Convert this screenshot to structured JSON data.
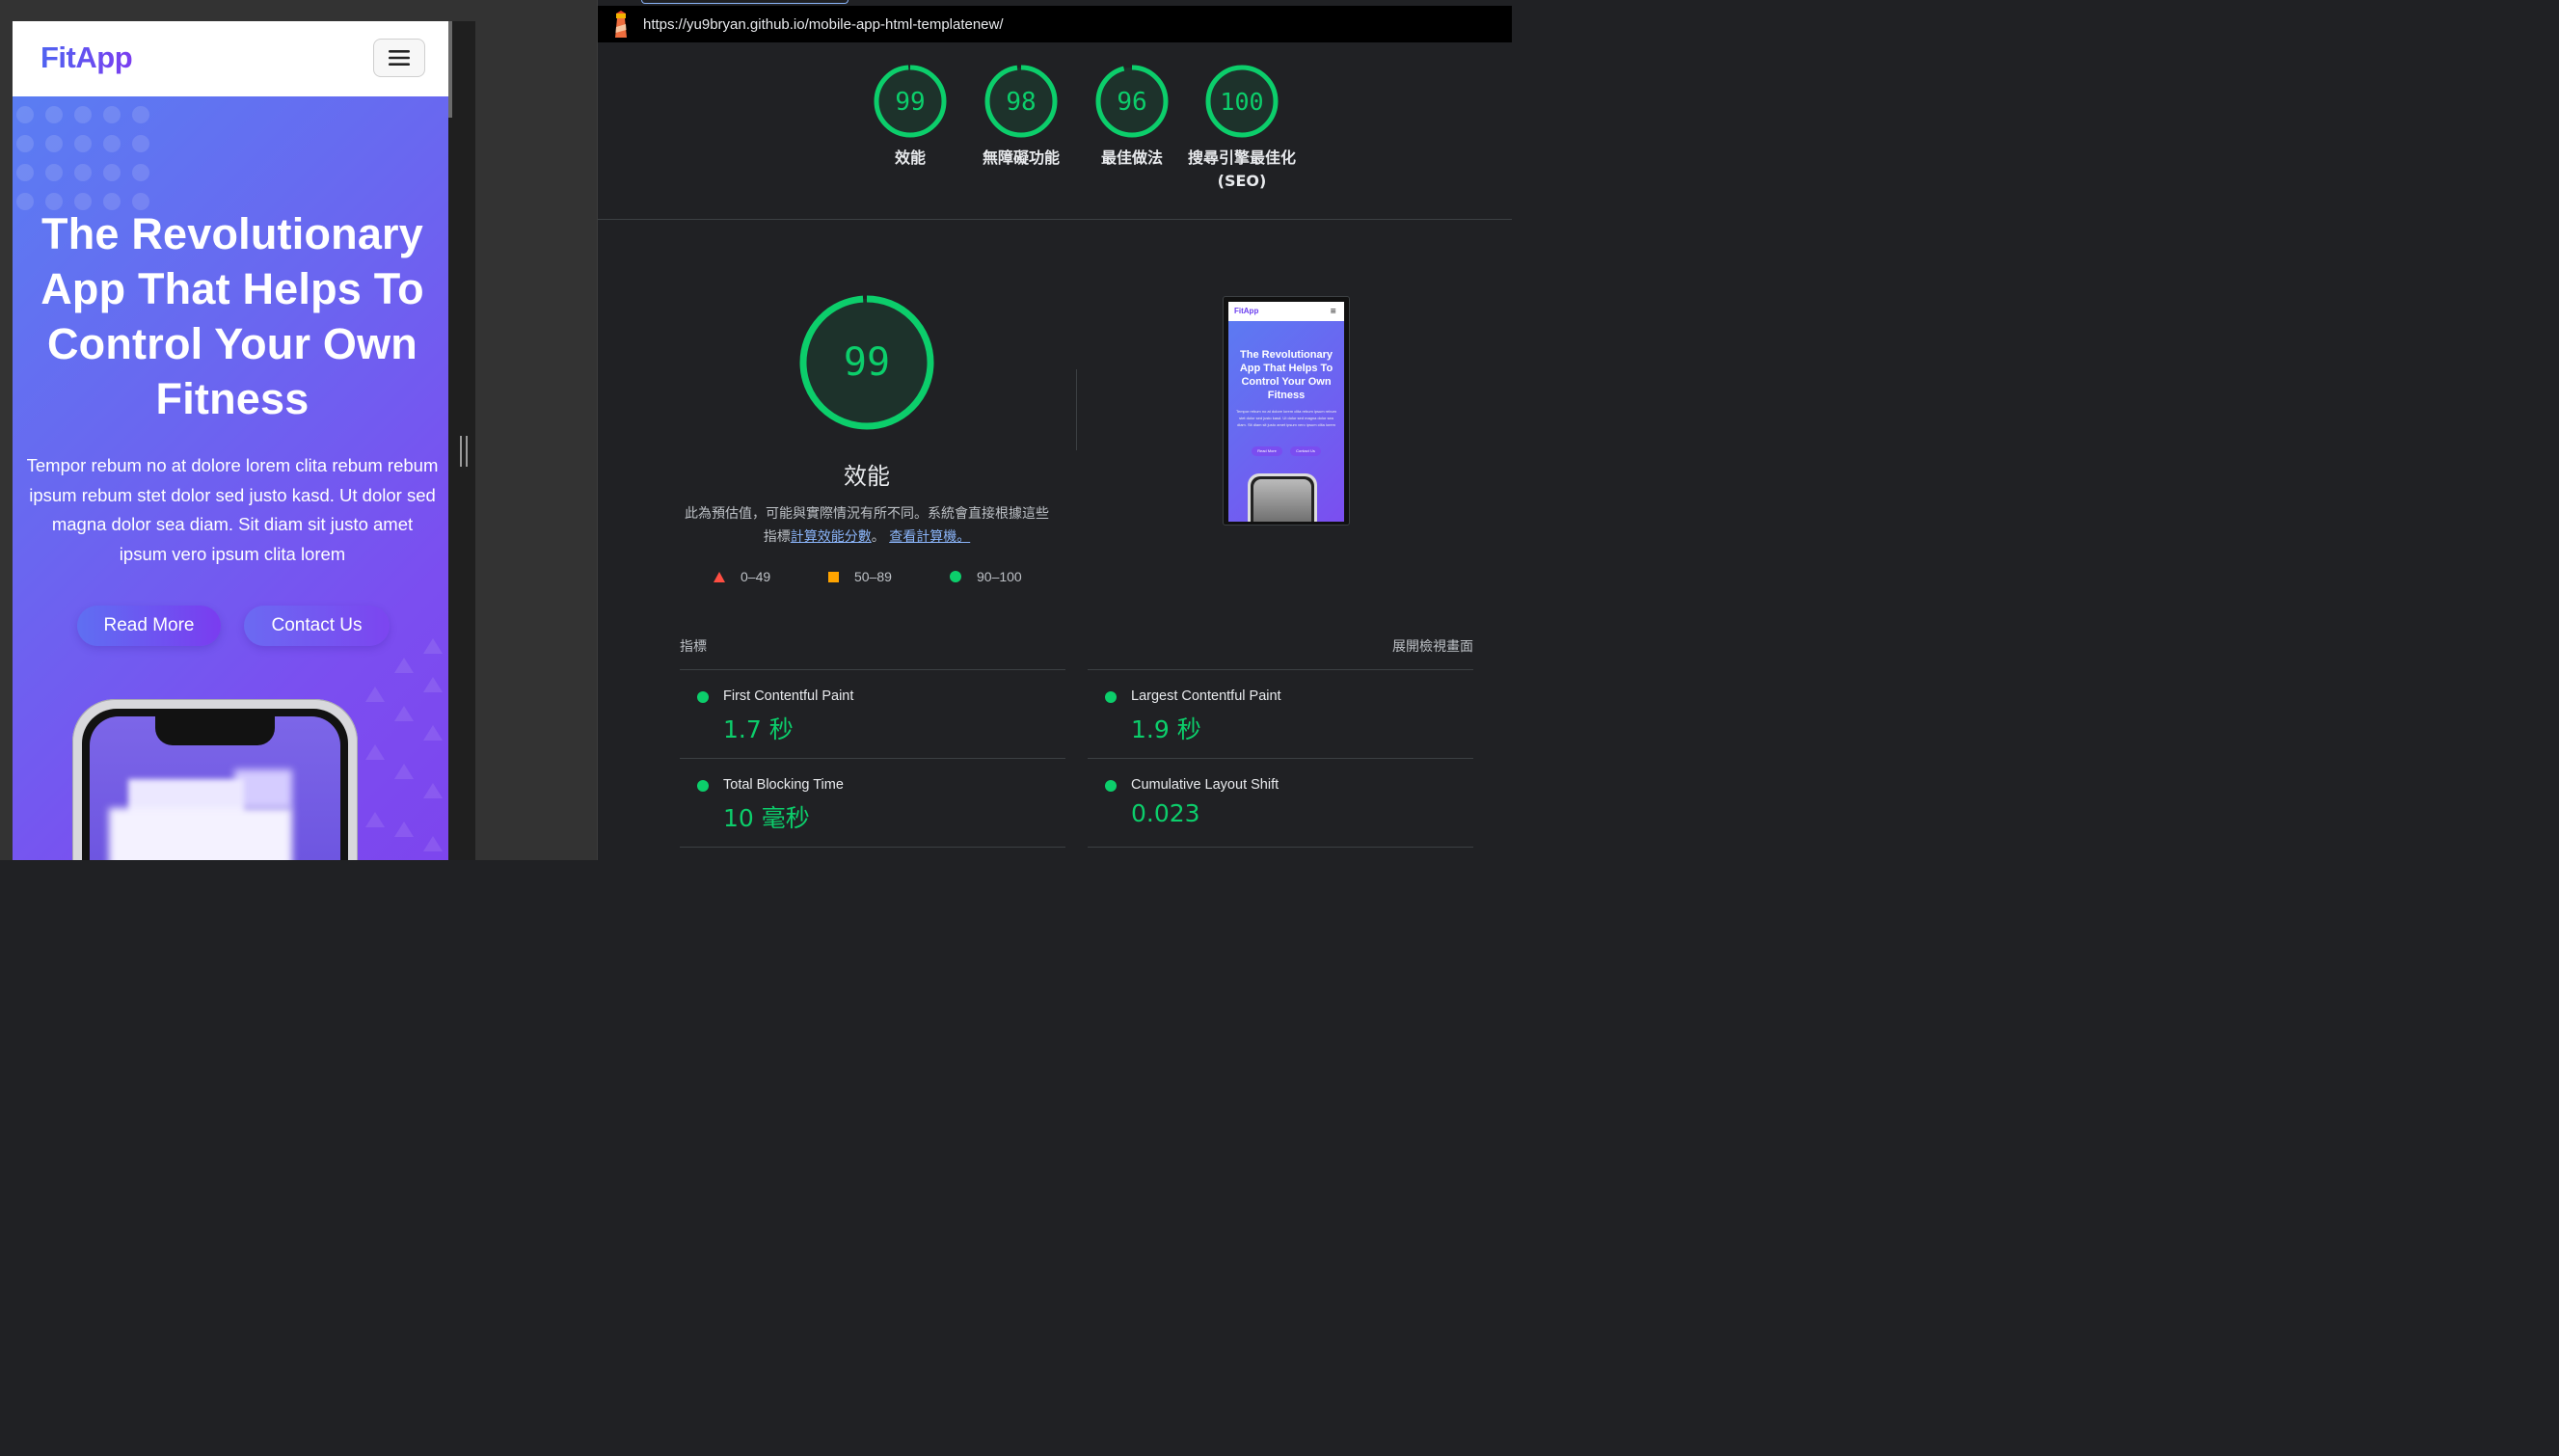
{
  "mobile": {
    "logo": "FitApp",
    "hero_title": "The Revolutionary App That Helps To Control Your Own Fitness",
    "hero_text": "Tempor rebum no at dolore lorem clita rebum rebum ipsum rebum stet dolor sed justo kasd. Ut dolor sed magna dolor sea diam. Sit diam sit justo amet ipsum vero ipsum clita lorem",
    "read_more": "Read More",
    "contact_us": "Contact Us",
    "menu_icon": "hamburger-icon"
  },
  "report": {
    "url": "https://yu9bryan.github.io/mobile-app-html-templatenew/",
    "scores": [
      {
        "value": "99",
        "label": "效能",
        "label2": ""
      },
      {
        "value": "98",
        "label": "無障礙功能",
        "label2": ""
      },
      {
        "value": "96",
        "label": "最佳做法",
        "label2": ""
      },
      {
        "value": "100",
        "label": "搜尋引擎最佳化",
        "label2": "(SEO)"
      }
    ],
    "performance": {
      "score": "99",
      "label": "效能",
      "desc_line1": "此為預估值，可能與實際情況有所不同。系統會直接根據這些",
      "desc_prefix": "指標",
      "desc_link1": "計算效能分數",
      "desc_mid": "。",
      "desc_link2": "查看計算機。"
    },
    "legend": [
      {
        "range": "0–49",
        "shape": "triangle",
        "color": "#ff4e42"
      },
      {
        "range": "50–89",
        "shape": "square",
        "color": "#ffa400"
      },
      {
        "range": "90–100",
        "shape": "circle",
        "color": "#0cce6b"
      }
    ],
    "thumbnail": {
      "logo": "FitApp",
      "menu": "≡",
      "title": "The Revolutionary App That Helps To Control Your Own Fitness",
      "text": "Tempor rebum no at dolore lorem clita rebum ipsum rebum stet dolor sed justo kasd. Ut dolor sed magna dolor sea diam. Sit diam sit justo amet ipsum vero ipsum clita lorem",
      "btn1": "Read More",
      "btn2": "Contact Us"
    },
    "metrics_title": "指標",
    "expand_label": "展開檢視畫面",
    "metrics": [
      {
        "name": "First Contentful Paint",
        "value": "1.7 秒"
      },
      {
        "name": "Largest Contentful Paint",
        "value": "1.9 秒"
      },
      {
        "name": "Total Blocking Time",
        "value": "10 毫秒"
      },
      {
        "name": "Cumulative Layout Shift",
        "value": "0.023"
      }
    ],
    "colors": {
      "pass": "#0cce6b",
      "average": "#ffa400",
      "fail": "#ff4e42",
      "link": "#8ab4f8"
    }
  }
}
